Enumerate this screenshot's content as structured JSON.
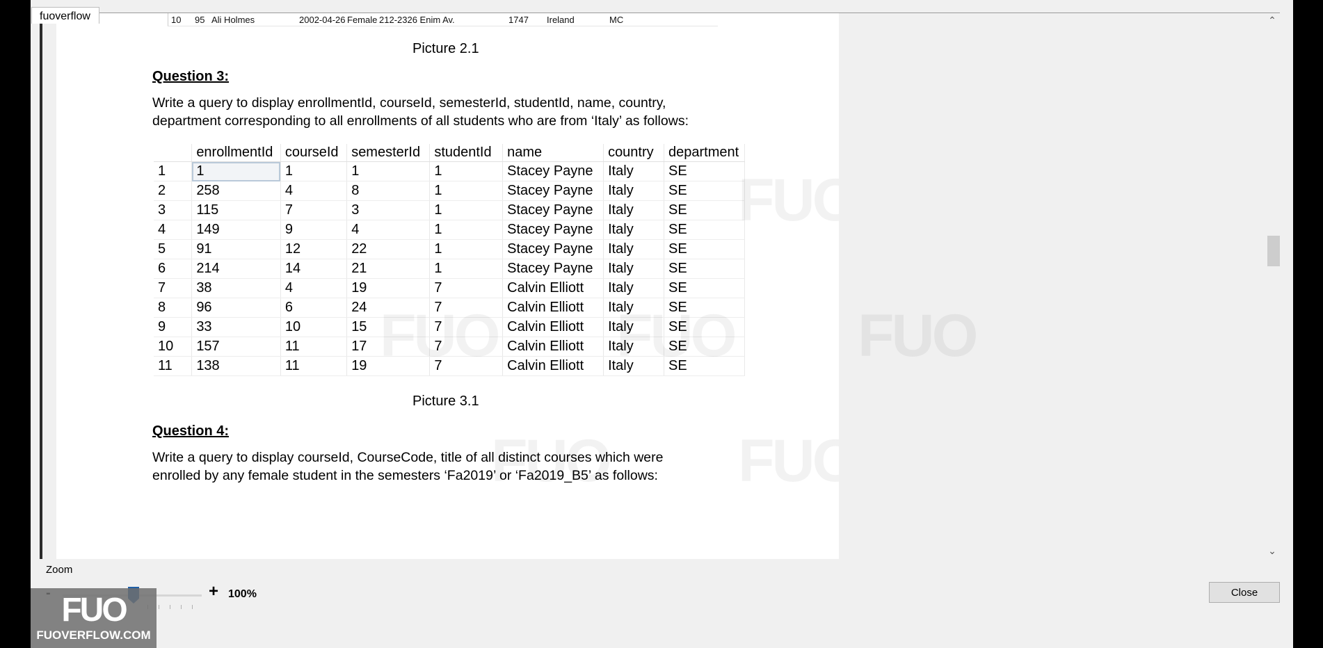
{
  "window": {
    "tab_title": "fuoverflow"
  },
  "document": {
    "prev_row": {
      "no": "10",
      "id": "95",
      "name": "Ali Holmes",
      "dob": "2002-04-26",
      "gender": "Female",
      "address": "212-2326 Enim Av.",
      "code": "1747",
      "country": "Ireland",
      "dept": "MC"
    },
    "caption_2_1": "Picture 2.1",
    "q3_heading": "Question 3:",
    "q3_text_line1": "Write a query to display enrollmentId, courseId, semesterId, studentId, name, country,",
    "q3_text_line2": "department corresponding to all enrollments of all students who are from ‘Italy’ as follows:",
    "table": {
      "headers": [
        "",
        "enrollmentId",
        "courseId",
        "semesterId",
        "studentId",
        "name",
        "country",
        "department"
      ],
      "rows": [
        [
          "1",
          "1",
          "1",
          "1",
          "1",
          "Stacey Payne",
          "Italy",
          "SE"
        ],
        [
          "2",
          "258",
          "4",
          "8",
          "1",
          "Stacey Payne",
          "Italy",
          "SE"
        ],
        [
          "3",
          "115",
          "7",
          "3",
          "1",
          "Stacey Payne",
          "Italy",
          "SE"
        ],
        [
          "4",
          "149",
          "9",
          "4",
          "1",
          "Stacey Payne",
          "Italy",
          "SE"
        ],
        [
          "5",
          "91",
          "12",
          "22",
          "1",
          "Stacey Payne",
          "Italy",
          "SE"
        ],
        [
          "6",
          "214",
          "14",
          "21",
          "1",
          "Stacey Payne",
          "Italy",
          "SE"
        ],
        [
          "7",
          "38",
          "4",
          "19",
          "7",
          "Calvin Elliott",
          "Italy",
          "SE"
        ],
        [
          "8",
          "96",
          "6",
          "24",
          "7",
          "Calvin Elliott",
          "Italy",
          "SE"
        ],
        [
          "9",
          "33",
          "10",
          "15",
          "7",
          "Calvin Elliott",
          "Italy",
          "SE"
        ],
        [
          "10",
          "157",
          "11",
          "17",
          "7",
          "Calvin Elliott",
          "Italy",
          "SE"
        ],
        [
          "11",
          "138",
          "11",
          "19",
          "7",
          "Calvin Elliott",
          "Italy",
          "SE"
        ]
      ]
    },
    "caption_3_1": "Picture 3.1",
    "q4_heading": "Question 4:",
    "q4_text_line1": "Write a query to display courseId, CourseCode, title of all distinct courses which were",
    "q4_text_line2": "enrolled by any female student in the semesters ‘Fa2019’ or ‘Fa2019_B5’ as follows:",
    "watermark": "FUO"
  },
  "zoom": {
    "label": "Zoom",
    "minus": "-",
    "plus": "+",
    "value": "100%"
  },
  "buttons": {
    "close": "Close"
  },
  "logo": {
    "big": "FUO",
    "small": "FUOVERFLOW.COM"
  }
}
